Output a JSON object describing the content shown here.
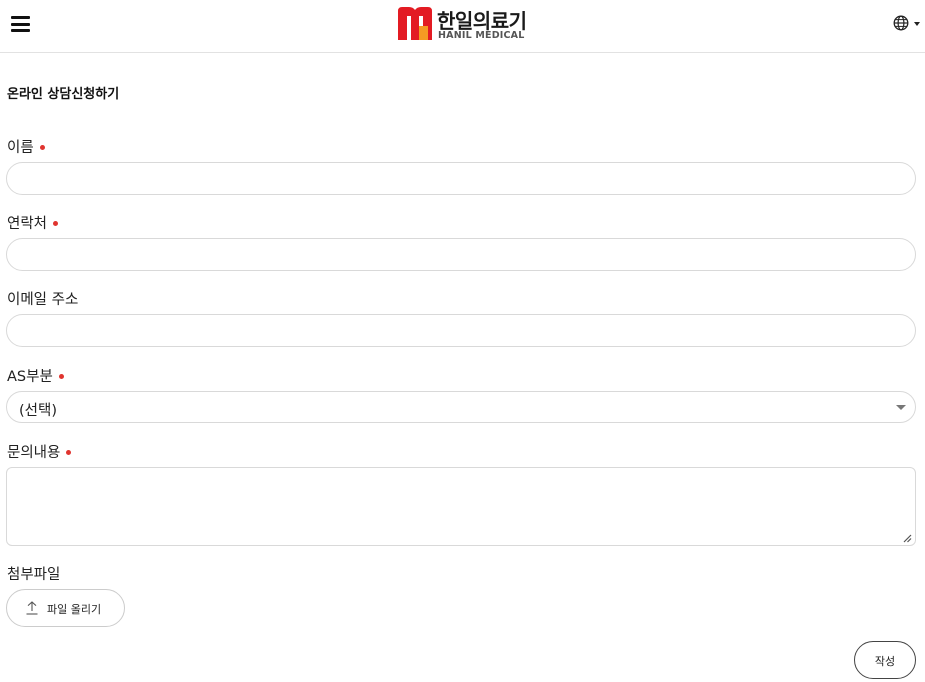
{
  "header": {
    "logo_ko": "한일의료기",
    "logo_en": "HANIL MEDICAL",
    "logo_colors": {
      "red": "#e31b23",
      "orange": "#f59a23"
    },
    "menu_icon": "hamburger-menu-icon",
    "language_icon": "globe-icon"
  },
  "form": {
    "title": "온라인 상담신청하기",
    "fields": {
      "name_label": "이름",
      "name_value": "",
      "phone_label": "연락처",
      "phone_value": "",
      "email_label": "이메일 주소",
      "email_value": "",
      "as_label": "AS부분",
      "as_selected": "(선택)",
      "inquiry_label": "문의내용",
      "inquiry_value": "",
      "attachment_label": "첨부파일"
    },
    "required_color": "#e0342f",
    "upload_button": "파일 올리기",
    "upload_icon": "upload-icon",
    "submit_button": "작성"
  }
}
